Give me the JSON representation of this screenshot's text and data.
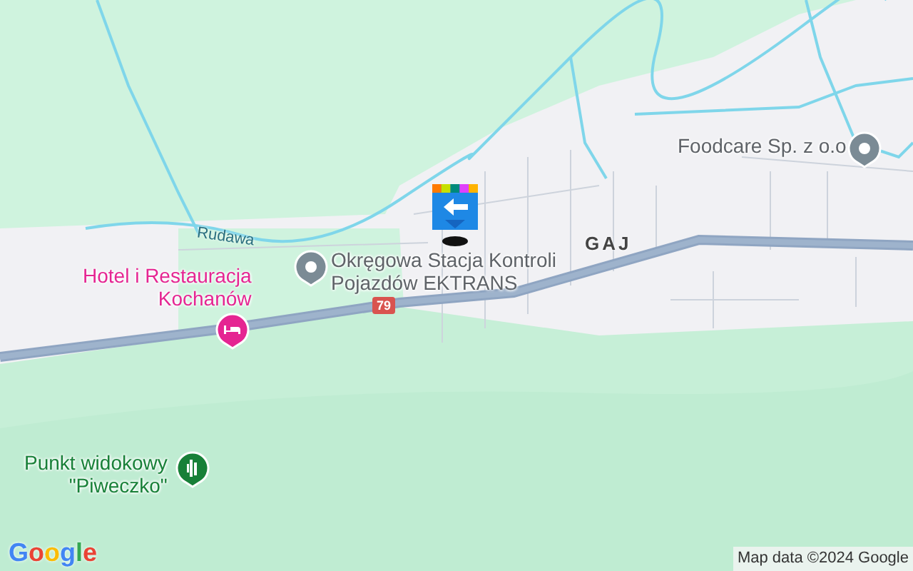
{
  "map": {
    "places": [
      {
        "kind": "business",
        "lines": [
          "Okręgowa Stacja Kontroli",
          "Pojazdów EKTRANS"
        ],
        "color": "#5f6368"
      },
      {
        "kind": "hotel",
        "lines": [
          "Hotel i Restauracja",
          "Kochanów"
        ],
        "color": "#e52592"
      },
      {
        "kind": "viewpoint",
        "lines": [
          "Punkt widokowy",
          "\"Piweczko\""
        ],
        "color": "#188038"
      },
      {
        "kind": "business",
        "lines": [
          "Foodcare Sp. z o.o"
        ],
        "color": "#5f6368"
      }
    ],
    "area_label": "GAJ",
    "river_label": "Rudawa",
    "road_shield": "79"
  },
  "logo": "Google",
  "attribution": "Map data ©2024 Google"
}
